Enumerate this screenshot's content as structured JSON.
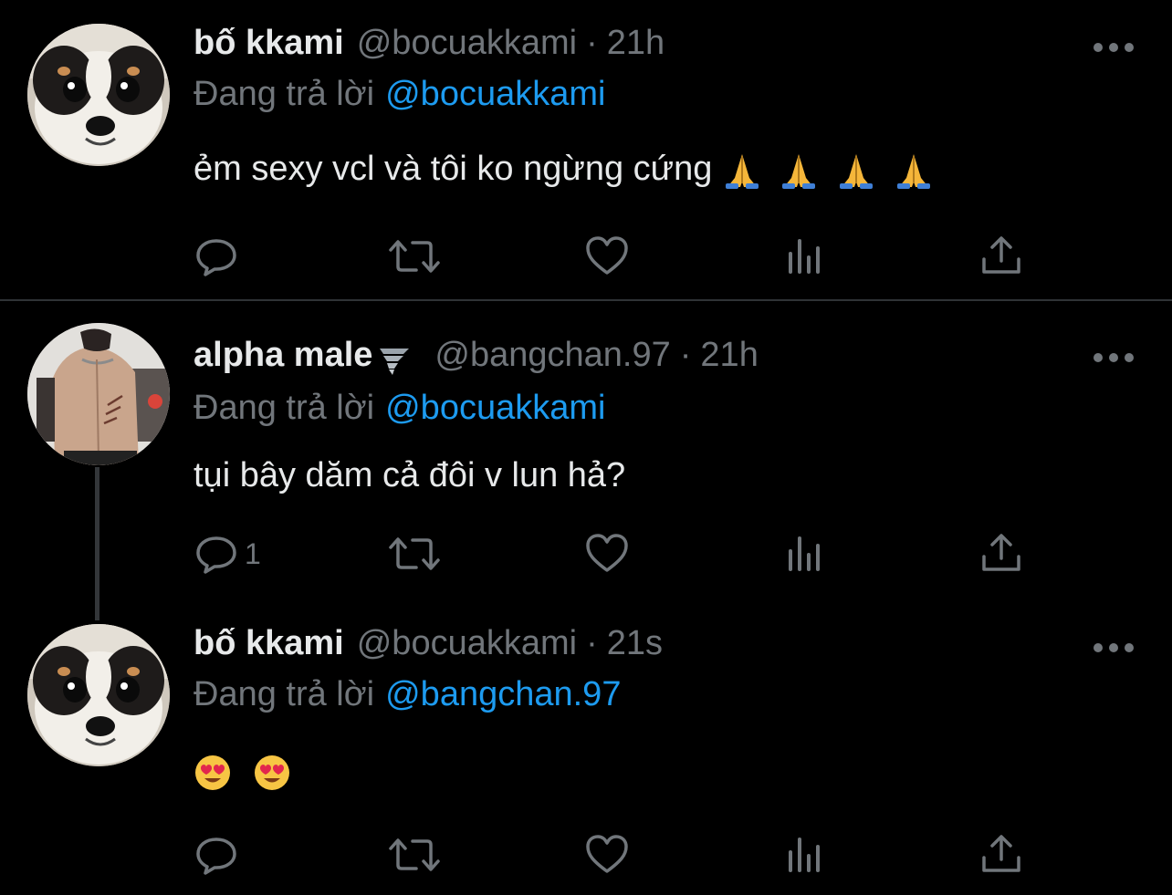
{
  "tweets": [
    {
      "name": "bố kkami",
      "handle": "@bocuakkami",
      "separator": "·",
      "time": "21h",
      "reply_prefix": "Đang trả lời",
      "reply_to": "@bocuakkami",
      "text": "ẻm sexy vcl và tôi ko ngừng cứng",
      "emoji_names": [
        "folded-hands",
        "folded-hands",
        "folded-hands",
        "folded-hands"
      ],
      "reply_count": ""
    },
    {
      "name": "alpha male",
      "name_emoji": "tornado",
      "handle": "@bangchan.97",
      "separator": "·",
      "time": "21h",
      "reply_prefix": "Đang trả lời",
      "reply_to": "@bocuakkami",
      "text": "tụi bây dăm cả đôi v lun hả?",
      "reply_count": "1"
    },
    {
      "name": "bố kkami",
      "handle": "@bocuakkami",
      "separator": "·",
      "time": "21s",
      "reply_prefix": "Đang trả lời",
      "reply_to": "@bangchan.97",
      "text": "",
      "emoji_names": [
        "smiling-face-with-heart-eyes",
        "smiling-face-with-heart-eyes"
      ],
      "reply_count": ""
    }
  ],
  "colors": {
    "background": "#000000",
    "text_primary": "#e7e9ea",
    "text_secondary": "#71767b",
    "accent": "#1d9bf0",
    "divider": "#2f3336"
  },
  "icons": [
    "reply-icon",
    "retweet-icon",
    "like-icon",
    "views-icon",
    "share-icon",
    "more-icon"
  ]
}
